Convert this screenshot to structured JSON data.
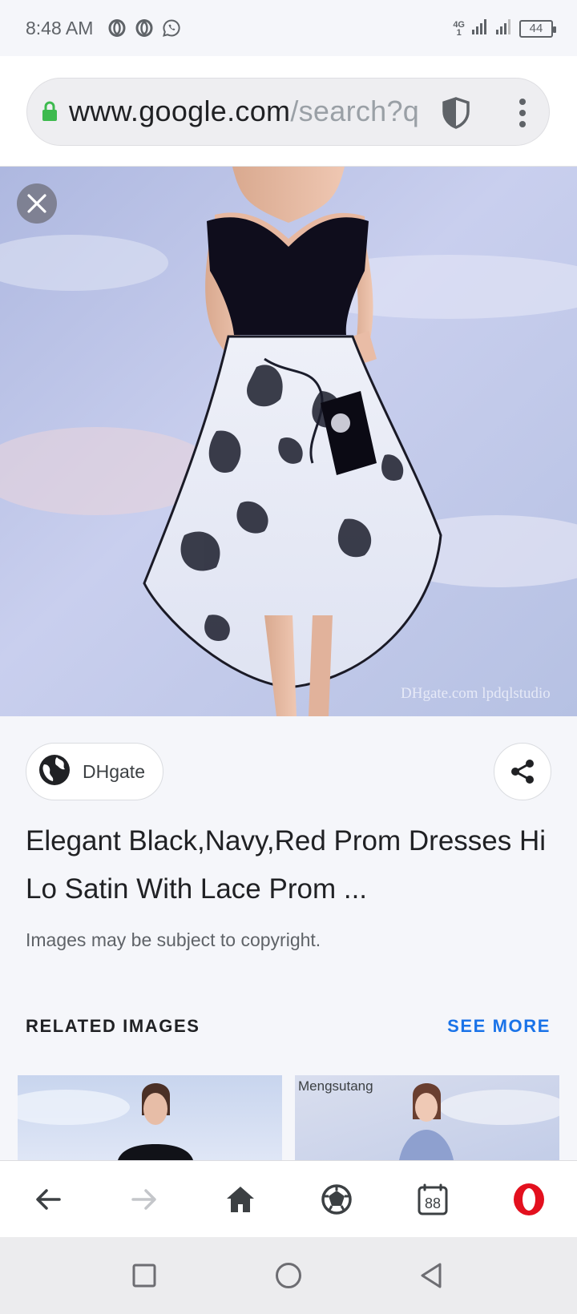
{
  "status_bar": {
    "time": "8:48 AM",
    "left_icons": [
      "opera-icon",
      "opera-icon",
      "whatsapp-icon"
    ],
    "network_label_top": "4G",
    "network_label_bottom": "1",
    "battery": "44"
  },
  "browser": {
    "url_main": "www.google.com",
    "url_rest": "/search?q"
  },
  "image_viewer": {
    "watermark": "DHgate.com  lpdqlstudio",
    "source_label": "DHgate",
    "title": "Elegant Black,Navy,Red Prom Dresses Hi Lo Satin With Lace Prom ...",
    "copyright_notice": "Images may be subject to copyright."
  },
  "related": {
    "heading": "RELATED IMAGES",
    "see_more_label": "SEE MORE",
    "thumbnails": [
      {
        "caption": ""
      },
      {
        "caption": "Mengsutang"
      }
    ]
  },
  "bottom_nav": {
    "tabs_count": "88",
    "items": [
      "back-icon",
      "forward-icon",
      "home-icon",
      "speed-dial-icon",
      "tabs-icon",
      "opera-menu-icon"
    ]
  },
  "colors": {
    "accent": "#1a73e8",
    "opera_red": "#e3101e",
    "lock_green": "#3dba4e"
  }
}
